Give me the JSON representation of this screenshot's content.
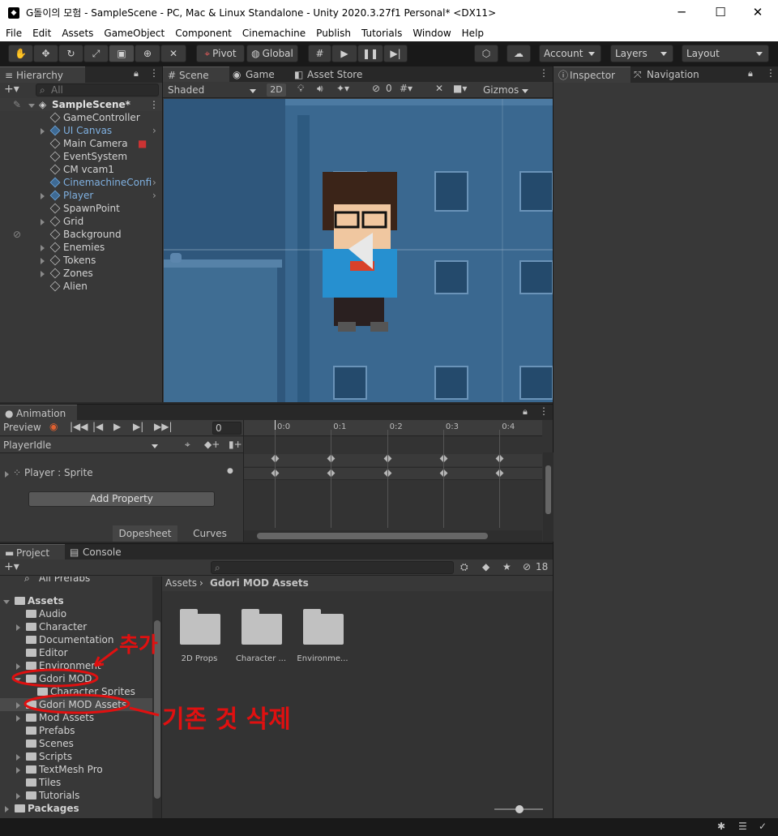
{
  "window": {
    "title": "G돌이의 모험 - SampleScene - PC, Mac & Linux Standalone - Unity 2020.3.27f1 Personal* <DX11>",
    "minimize": "─",
    "maximize": "☐",
    "close": "✕"
  },
  "menu": [
    "File",
    "Edit",
    "Assets",
    "GameObject",
    "Component",
    "Cinemachine",
    "Publish",
    "Tutorials",
    "Window",
    "Help"
  ],
  "toolbar": {
    "pivot": "Pivot",
    "global": "Global",
    "account": "Account",
    "layers": "Layers",
    "layout": "Layout"
  },
  "hierarchy": {
    "tab": "Hierarchy",
    "search_placeholder": "All",
    "scene": "SampleScene*",
    "items": [
      {
        "label": "GameController",
        "blue": false,
        "foldout": false,
        "child_arrow": false
      },
      {
        "label": "UI Canvas",
        "blue": true,
        "foldout": true,
        "child_arrow": true
      },
      {
        "label": "Main Camera",
        "blue": false,
        "foldout": false,
        "child_arrow": false
      },
      {
        "label": "EventSystem",
        "blue": false,
        "foldout": false,
        "child_arrow": false
      },
      {
        "label": "CM vcam1",
        "blue": false,
        "foldout": false,
        "child_arrow": false
      },
      {
        "label": "CinemachineConfi",
        "blue": true,
        "foldout": false,
        "child_arrow": true
      },
      {
        "label": "Player",
        "blue": true,
        "foldout": true,
        "child_arrow": true
      },
      {
        "label": "SpawnPoint",
        "blue": false,
        "foldout": false,
        "child_arrow": false
      },
      {
        "label": "Grid",
        "blue": false,
        "foldout": true,
        "child_arrow": false
      },
      {
        "label": "Background",
        "blue": false,
        "foldout": false,
        "child_arrow": false
      },
      {
        "label": "Enemies",
        "blue": false,
        "foldout": true,
        "child_arrow": false
      },
      {
        "label": "Tokens",
        "blue": false,
        "foldout": true,
        "child_arrow": false
      },
      {
        "label": "Zones",
        "blue": false,
        "foldout": true,
        "child_arrow": false
      },
      {
        "label": "Alien",
        "blue": false,
        "foldout": false,
        "child_arrow": false
      }
    ]
  },
  "scene": {
    "tabs": [
      "Scene",
      "Game",
      "Asset Store"
    ],
    "shading": "Shaded",
    "mode2d": "2D",
    "hidden_count": "0",
    "gizmos": "Gizmos"
  },
  "inspector": {
    "tabs": [
      "Inspector",
      "Navigation"
    ]
  },
  "animation": {
    "tab": "Animation",
    "preview": "Preview",
    "frame": "0",
    "clip": "PlayerIdle",
    "ruler": [
      "0:0",
      "0:1",
      "0:2",
      "0:3",
      "0:4"
    ],
    "property": "Player : Sprite",
    "add_property": "Add Property",
    "dopesheet": "Dopesheet",
    "curves": "Curves"
  },
  "project": {
    "tabs": [
      "Project",
      "Console"
    ],
    "badge": "18",
    "breadcrumb": {
      "root": "Assets",
      "current": "Gdori MOD Assets"
    },
    "tree_top": "All Prefabs",
    "tree": [
      "Assets",
      "Audio",
      "Character",
      "Documentation",
      "Editor",
      "Environment",
      "Gdori MOD",
      "Character Sprites",
      "Gdori MOD Assets",
      "Mod Assets",
      "Prefabs",
      "Scenes",
      "Scripts",
      "TextMesh Pro",
      "Tiles",
      "Tutorials",
      "Packages"
    ],
    "folders": [
      "2D Props",
      "Character ...",
      "Environme..."
    ]
  },
  "annotations": {
    "add": "추가",
    "delete": "기존 것 삭제"
  },
  "colors": {
    "accent": "#2c5d87",
    "sky": "#2f577c",
    "annotation": "#e01010"
  }
}
